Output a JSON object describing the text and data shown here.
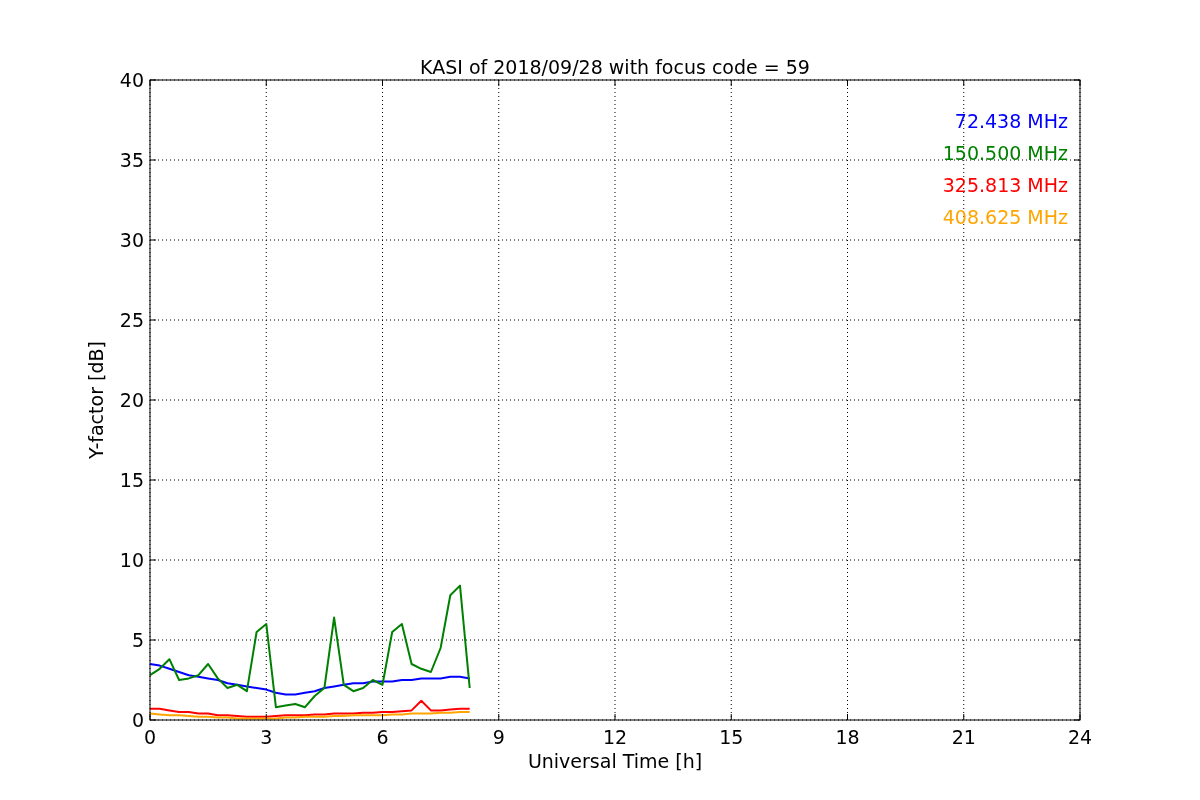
{
  "chart_data": {
    "type": "line",
    "title": "KASI of 2018/09/28 with focus code = 59",
    "xlabel": "Universal Time [h]",
    "ylabel": "Y-factor [dB]",
    "x": [
      0,
      0.25,
      0.5,
      0.75,
      1,
      1.25,
      1.5,
      1.75,
      2,
      2.25,
      2.5,
      2.75,
      3,
      3.25,
      3.5,
      3.75,
      4,
      4.25,
      4.5,
      4.75,
      5,
      5.25,
      5.5,
      5.75,
      6,
      6.25,
      6.5,
      6.75,
      7,
      7.25,
      7.5,
      7.75,
      8,
      8.25
    ],
    "series": [
      {
        "name": "72.438 MHz",
        "color": "#0000ff",
        "values": [
          3.5,
          3.4,
          3.2,
          3.0,
          2.8,
          2.7,
          2.6,
          2.5,
          2.3,
          2.2,
          2.1,
          2.0,
          1.9,
          1.7,
          1.6,
          1.6,
          1.7,
          1.8,
          2.0,
          2.1,
          2.2,
          2.3,
          2.3,
          2.4,
          2.4,
          2.4,
          2.5,
          2.5,
          2.6,
          2.6,
          2.6,
          2.7,
          2.7,
          2.6
        ]
      },
      {
        "name": "150.500 MHz",
        "color": "#008000",
        "values": [
          2.8,
          3.2,
          3.8,
          2.5,
          2.6,
          2.8,
          3.5,
          2.6,
          2.0,
          2.2,
          1.8,
          5.5,
          6.0,
          0.8,
          0.9,
          1.0,
          0.8,
          1.5,
          2.0,
          6.4,
          2.2,
          1.8,
          2.0,
          2.5,
          2.2,
          5.5,
          6.0,
          3.5,
          3.2,
          3.0,
          4.5,
          7.8,
          8.4,
          2.0
        ]
      },
      {
        "name": "325.813 MHz",
        "color": "#ff0000",
        "values": [
          0.7,
          0.7,
          0.6,
          0.5,
          0.5,
          0.4,
          0.4,
          0.3,
          0.3,
          0.25,
          0.2,
          0.2,
          0.2,
          0.25,
          0.3,
          0.3,
          0.3,
          0.35,
          0.35,
          0.4,
          0.4,
          0.4,
          0.45,
          0.45,
          0.5,
          0.5,
          0.55,
          0.6,
          1.2,
          0.6,
          0.6,
          0.65,
          0.7,
          0.7
        ]
      },
      {
        "name": "408.625 MHz",
        "color": "#ffa500",
        "values": [
          0.4,
          0.35,
          0.3,
          0.3,
          0.25,
          0.2,
          0.2,
          0.15,
          0.15,
          0.1,
          0.1,
          0.1,
          0.1,
          0.1,
          0.15,
          0.15,
          0.2,
          0.2,
          0.2,
          0.25,
          0.25,
          0.3,
          0.3,
          0.3,
          0.3,
          0.35,
          0.35,
          0.4,
          0.4,
          0.4,
          0.45,
          0.45,
          0.5,
          0.5
        ]
      }
    ],
    "grid": true,
    "xlim": [
      0,
      24
    ],
    "ylim": [
      0,
      40
    ],
    "xticks": [
      0,
      3,
      6,
      9,
      12,
      15,
      18,
      21,
      24
    ],
    "yticks": [
      0,
      5,
      10,
      15,
      20,
      25,
      30,
      35,
      40
    ]
  }
}
